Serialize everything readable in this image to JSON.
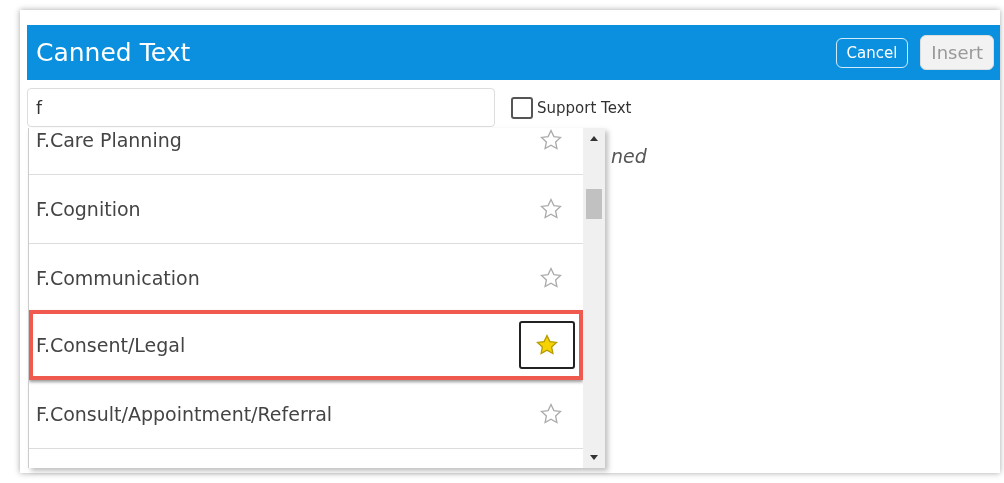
{
  "dialog": {
    "title": "Canned Text",
    "buttons": [
      {
        "label": "Cancel",
        "disabled": false
      },
      {
        "label": "Insert",
        "disabled": true
      }
    ]
  },
  "search": {
    "value": "f"
  },
  "support_text": {
    "label": "Support Text",
    "checked": false
  },
  "background_text": "ned",
  "items": [
    {
      "name": "F.Care Planning",
      "favorite": false,
      "highlighted": false
    },
    {
      "name": "F.Cognition",
      "favorite": false,
      "highlighted": false
    },
    {
      "name": "F.Communication",
      "favorite": false,
      "highlighted": false
    },
    {
      "name": "F.Consent/Legal",
      "favorite": true,
      "highlighted": true
    },
    {
      "name": "F.Consult/Appointment/Referral",
      "favorite": false,
      "highlighted": false
    }
  ]
}
